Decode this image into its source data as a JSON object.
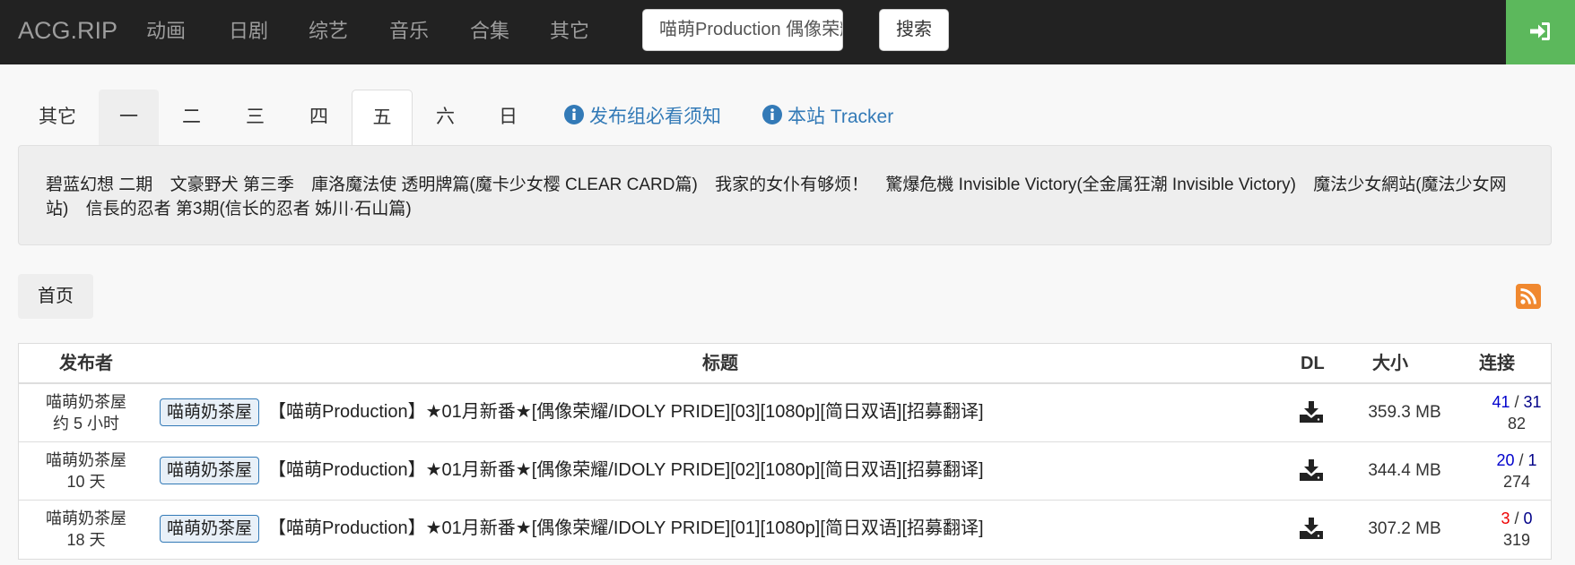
{
  "navbar": {
    "brand": "ACG.RIP",
    "items": [
      "动画",
      "日剧",
      "综艺",
      "音乐",
      "合集",
      "其它"
    ],
    "search_value": "喵萌Production 偶像荣耀",
    "search_button": "搜索"
  },
  "tabs": {
    "items": [
      "其它",
      "一",
      "二",
      "三",
      "四",
      "五",
      "六",
      "日"
    ],
    "active": "五",
    "links": [
      "发布组必看须知",
      "本站 Tracker"
    ]
  },
  "schedule": {
    "shows": [
      "碧蓝幻想 二期",
      "文豪野犬 第三季",
      "庫洛魔法使 透明牌篇(魔卡少女樱 CLEAR CARD篇)",
      "我家的女仆有够烦！",
      "驚爆危機 Invisible Victory(全金属狂潮 Invisible Victory)",
      "魔法少女網站(魔法少女网站)",
      "信長的忍者 第3期(信长的忍者 姊川·石山篇)"
    ]
  },
  "breadcrumb": {
    "home": "首页"
  },
  "table": {
    "headers": {
      "publisher": "发布者",
      "title": "标题",
      "dl": "DL",
      "size": "大小",
      "connections": "连接"
    },
    "rows": [
      {
        "publisher": "喵萌奶茶屋",
        "time": "约 5 小时",
        "team": "喵萌奶茶屋",
        "title": "【喵萌Production】★01月新番★[偶像荣耀/IDOLY PRIDE][03][1080p][简日双语][招募翻译]",
        "size": "359.3 MB",
        "seeders": "41",
        "leechers": "31",
        "completed": "82"
      },
      {
        "publisher": "喵萌奶茶屋",
        "time": "10 天",
        "team": "喵萌奶茶屋",
        "title": "【喵萌Production】★01月新番★[偶像荣耀/IDOLY PRIDE][02][1080p][简日双语][招募翻译]",
        "size": "344.4 MB",
        "seeders": "20",
        "leechers": "1",
        "completed": "274"
      },
      {
        "publisher": "喵萌奶茶屋",
        "time": "18 天",
        "team": "喵萌奶茶屋",
        "title": "【喵萌Production】★01月新番★[偶像荣耀/IDOLY PRIDE][01][1080p][简日双语][招募翻译]",
        "size": "307.2 MB",
        "seeders": "3",
        "leechers": "0",
        "completed": "319"
      }
    ]
  },
  "colors": {
    "navbar_bg": "#222222",
    "login_green": "#5cb85c",
    "link_blue": "#337ab7",
    "rss_orange": "#f0882f",
    "seed_low_red": "#ee0000"
  },
  "icons": {
    "login": "sign-in-icon",
    "info": "info-circle-icon",
    "download": "download-icon",
    "rss": "rss-icon"
  }
}
